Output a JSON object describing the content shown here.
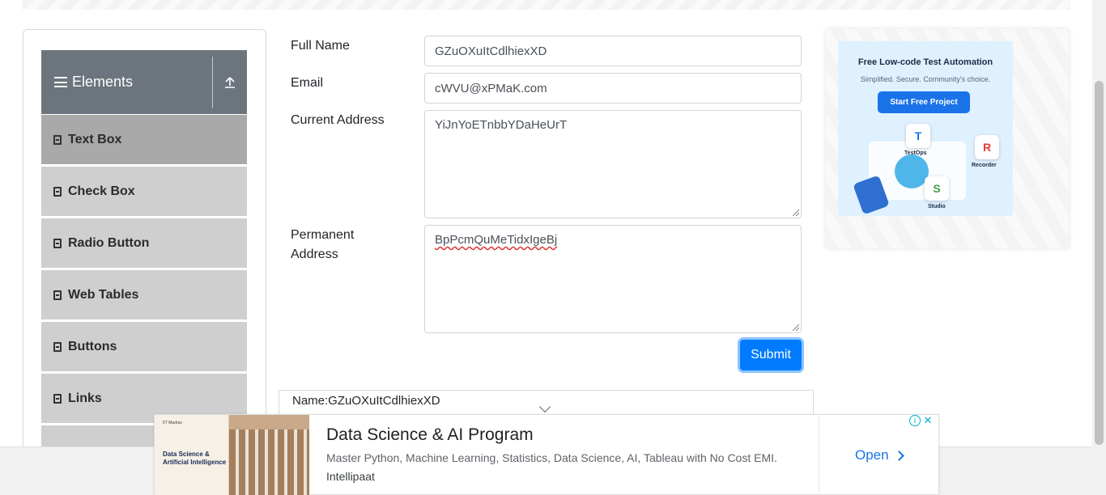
{
  "sidebar": {
    "group_title": "Elements",
    "items": [
      {
        "label": "Text Box",
        "active": true
      },
      {
        "label": "Check Box"
      },
      {
        "label": "Radio Button"
      },
      {
        "label": "Web Tables"
      },
      {
        "label": "Buttons"
      },
      {
        "label": "Links"
      }
    ]
  },
  "form": {
    "full_name_label": "Full Name",
    "full_name_value": "GZuOXuItCdlhiexXD",
    "email_label": "Email",
    "email_value": "cWVU@xPMaK.com",
    "current_address_label": "Current Address",
    "current_address_value": "YiJnYoETnbbYDaHeUrT",
    "permanent_address_label_line1": "Permanent",
    "permanent_address_label_line2": "Address",
    "permanent_address_value": "BpPcmQuMeTidxIgeBj",
    "submit_label": "Submit"
  },
  "output": {
    "name_line": "Name:GZuOXuItCdlhiexXD"
  },
  "side_ad": {
    "title": "Free Low-code Test Automation",
    "subtitle": "Simplified. Secure. Community's choice.",
    "cta": "Start Free Project",
    "tiles": [
      "TestOps",
      "Recorder",
      "Studio"
    ]
  },
  "bottom_ad": {
    "thumb_org": "IIT Madras",
    "thumb_title": "Data Science & Artificial Intelligence",
    "headline": "Data Science & AI Program",
    "description": "Master Python, Machine Learning, Statistics, Data Science, AI, Tableau with No Cost EMI.",
    "advertiser": "Intellipaat",
    "cta": "Open"
  },
  "colors": {
    "primary": "#007bff",
    "sidebar_header": "#6c757d",
    "menu_item": "#cfcfcf",
    "menu_item_active": "#a9a9a9"
  }
}
